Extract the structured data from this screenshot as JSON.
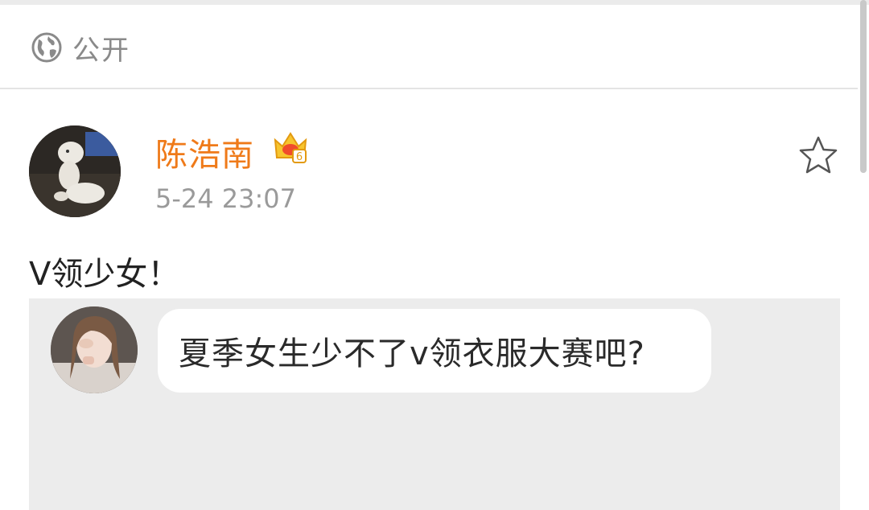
{
  "visibility": {
    "icon": "globe-icon",
    "label": "公开"
  },
  "post": {
    "author": {
      "name": "陈浩南",
      "badge_icon": "vip-crown-icon",
      "badge_number": "6",
      "avatar": "plush-toy-avatar"
    },
    "timestamp": "5-24 23:07",
    "favorite_icon": "star-outline-icon",
    "text": "V领少女！",
    "repost": {
      "avatar": "woman-avatar",
      "bubble_text": "夏季女生少不了v领衣服大赛吧?"
    }
  },
  "colors": {
    "username": "#ef7a19",
    "card_background": "#ececec",
    "muted_text": "#9a9a9a"
  }
}
